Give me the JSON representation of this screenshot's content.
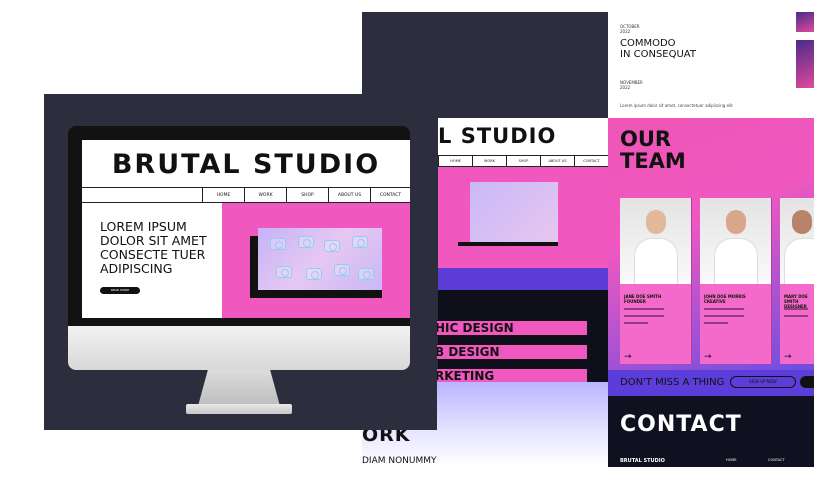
{
  "desktop": {
    "logo": "BRUTAL STUDIO",
    "nav": [
      "HOME",
      "WORK",
      "SHOP",
      "ABOUT US",
      "CONTACT"
    ],
    "hero_title_lines": [
      "LOREM IPSUM",
      "DOLOR SIT AMET",
      "CONSECTE TUER",
      "ADIPISCING"
    ],
    "hero_button": "READ MORE"
  },
  "preview": {
    "logo_partial": "L STUDIO",
    "nav": [
      "HOME",
      "WORK",
      "SHOP",
      "ABOUT US",
      "CONTACT"
    ],
    "services": [
      "HIC DESIGN",
      "B DESIGN",
      "RKETING"
    ],
    "work_heading": "ORK",
    "work_item": "DIAM NONUMMY"
  },
  "events": {
    "item1_date": [
      "OCTOBER",
      "2022"
    ],
    "item1_title": [
      "COMMODO",
      "IN CONSEQUAT"
    ],
    "item2_date": [
      "NOVEMBER",
      "2022"
    ],
    "footnote": "Lorem ipsum dolor sit amet, consectetuer adipiscing elit"
  },
  "team": {
    "title_lines": [
      "OUR",
      "TEAM"
    ],
    "members": [
      {
        "name": "JANE DOE SMITH",
        "role": "FOUNDER"
      },
      {
        "name": "JOHN DOE MORRIS",
        "role": "CREATIVE"
      },
      {
        "name": "MARY DOE SMITH",
        "role": "DESIGNER"
      }
    ],
    "arrow": "→"
  },
  "newsletter": {
    "text": "DON'T MISS A THING",
    "button": "SIGN UP NOW"
  },
  "contact": {
    "heading": "CONTACT",
    "footer_logo": "BRUTAL STUDIO",
    "footer_links": [
      "HOME",
      "CONTACT"
    ]
  },
  "colors": {
    "pink": "#f058c0",
    "purple": "#5c3cd6",
    "dark": "#2c2d3d"
  }
}
